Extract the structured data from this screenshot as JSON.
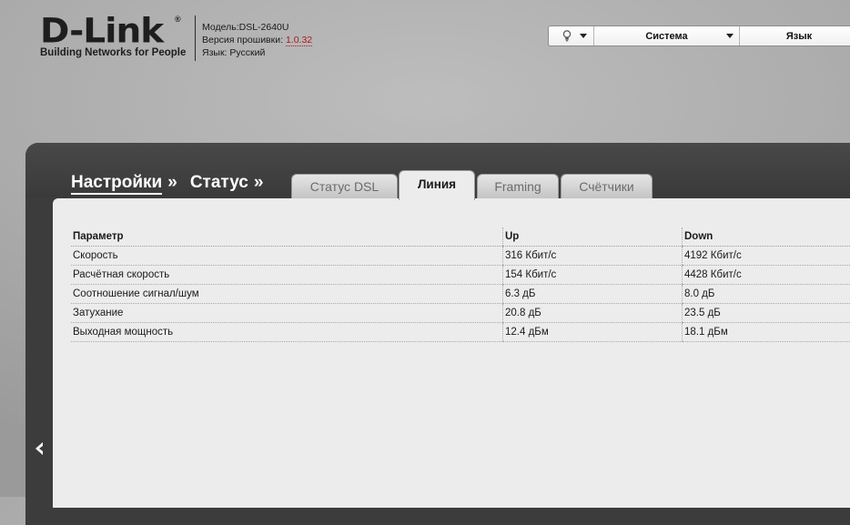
{
  "header": {
    "logo_text": "D-Link",
    "logo_reg": "®",
    "tagline": "Building Networks for People",
    "model_line": "Модель:DSL-2640U",
    "firmware_label": "Версия прошивки: ",
    "firmware_version": "1.0.32",
    "language_line": "Язык: Русский"
  },
  "toolbar": {
    "tips_icon": "lightbulb-icon",
    "system_label": "Система",
    "language_label": "Язык"
  },
  "breadcrumb": {
    "root": "Настройки",
    "current": "Статус",
    "separator": "»"
  },
  "tabs": [
    {
      "label": "Статус DSL",
      "active": false
    },
    {
      "label": "Линия",
      "active": true
    },
    {
      "label": "Framing",
      "active": false
    },
    {
      "label": "Счётчики",
      "active": false
    }
  ],
  "table": {
    "headers": {
      "param": "Параметр",
      "up": "Up",
      "down": "Down"
    },
    "rows": [
      {
        "param": "Скорость",
        "up": "316 Кбит/с",
        "down": "4192 Кбит/с"
      },
      {
        "param": "Расчётная скорость",
        "up": "154 Кбит/с",
        "down": "4428 Кбит/с"
      },
      {
        "param": "Соотношение сигнал/шум",
        "up": "6.3 дБ",
        "down": "8.0 дБ"
      },
      {
        "param": "Затухание",
        "up": "20.8 дБ",
        "down": "23.5 дБ"
      },
      {
        "param": "Выходная мощность",
        "up": "12.4 дБм",
        "down": "18.1 дБм"
      }
    ]
  },
  "sidebar": {
    "collapse_icon": "chevron-left-icon"
  },
  "colors": {
    "frame": "#3c3c3c",
    "panel": "#ececec",
    "accent_link": "#b0181d"
  }
}
